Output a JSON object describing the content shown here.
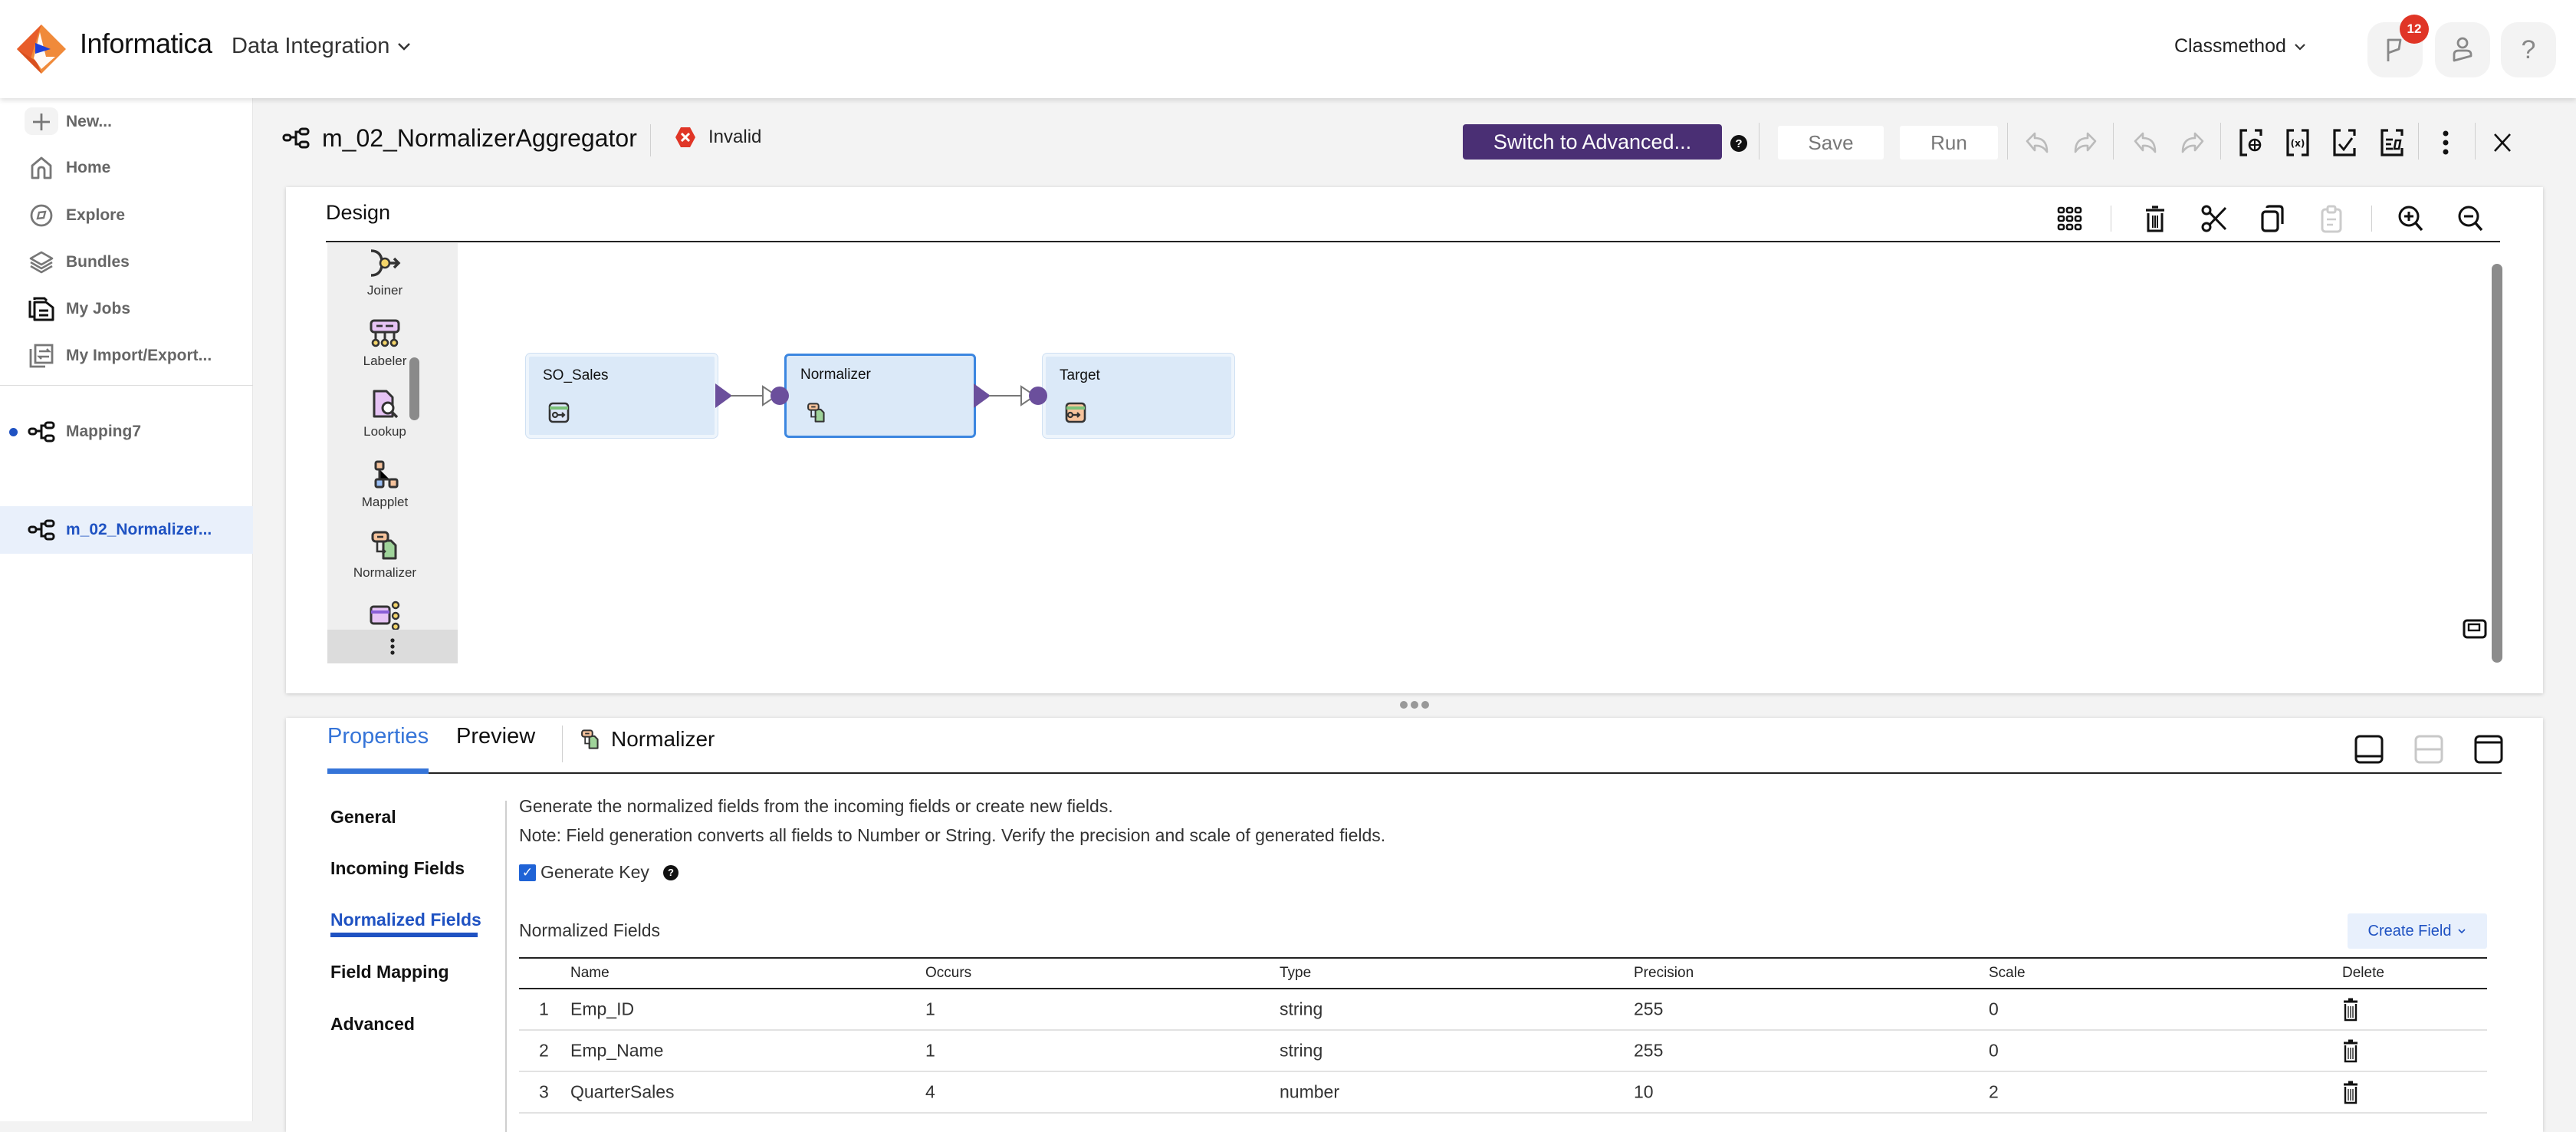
{
  "header": {
    "brand": "Informatica",
    "app_name": "Data Integration",
    "org_name": "Classmethod",
    "notifications_count": "12",
    "icons": [
      "notifications-flag-icon",
      "user-icon",
      "help-icon"
    ]
  },
  "nav": {
    "items": [
      {
        "label": "New...",
        "icon": "plus-icon"
      },
      {
        "label": "Home",
        "icon": "home-icon"
      },
      {
        "label": "Explore",
        "icon": "compass-icon"
      },
      {
        "label": "Bundles",
        "icon": "layers-icon"
      },
      {
        "label": "My Jobs",
        "icon": "jobs-icon"
      },
      {
        "label": "My Import/Export...",
        "icon": "import-export-icon"
      }
    ],
    "open_assets": [
      {
        "label": "Mapping7",
        "icon": "mapping-icon",
        "unsaved": true
      },
      {
        "label": "m_02_Normalizer...",
        "icon": "mapping-icon",
        "active": true
      }
    ]
  },
  "titlebar": {
    "mapping_name": "m_02_NormalizerAggregator",
    "status": "Invalid",
    "switch_advanced_label": "Switch to Advanced...",
    "save_label": "Save",
    "run_label": "Run"
  },
  "design": {
    "title": "Design",
    "palette": [
      {
        "label": "Joiner"
      },
      {
        "label": "Labeler"
      },
      {
        "label": "Lookup"
      },
      {
        "label": "Mapplet"
      },
      {
        "label": "Normalizer"
      }
    ],
    "nodes": [
      {
        "label": "SO_Sales",
        "kind": "source"
      },
      {
        "label": "Normalizer",
        "kind": "normalizer",
        "selected": true
      },
      {
        "label": "Target",
        "kind": "target"
      }
    ]
  },
  "properties": {
    "tabs": [
      {
        "label": "Properties",
        "active": true
      },
      {
        "label": "Preview"
      }
    ],
    "selected_object": "Normalizer",
    "side_menu": [
      {
        "label": "General"
      },
      {
        "label": "Incoming Fields"
      },
      {
        "label": "Normalized Fields",
        "active": true
      },
      {
        "label": "Field Mapping"
      },
      {
        "label": "Advanced"
      }
    ],
    "description_1": "Generate the normalized fields from the incoming fields or create new fields.",
    "description_2": "Note: Field generation converts all fields to Number or String. Verify the precision and scale of generated fields.",
    "generate_key_label": "Generate Key",
    "generate_key_checked": true,
    "section_label": "Normalized Fields",
    "create_field_label": "Create Field",
    "table": {
      "columns": [
        "Name",
        "Occurs",
        "Type",
        "Precision",
        "Scale",
        "Delete"
      ],
      "rows": [
        {
          "index": "1",
          "name": "Emp_ID",
          "occurs": "1",
          "type": "string",
          "precision": "255",
          "scale": "0"
        },
        {
          "index": "2",
          "name": "Emp_Name",
          "occurs": "1",
          "type": "string",
          "precision": "255",
          "scale": "0"
        },
        {
          "index": "3",
          "name": "QuarterSales",
          "occurs": "4",
          "type": "number",
          "precision": "10",
          "scale": "2"
        }
      ]
    }
  },
  "colors": {
    "accent_blue": "#1f52c2",
    "tab_blue": "#3574d8",
    "advanced_button": "#4a2f74",
    "error_red": "#e03526",
    "node_fill": "#dbe9f8",
    "port_purple": "#6b4f9c"
  }
}
